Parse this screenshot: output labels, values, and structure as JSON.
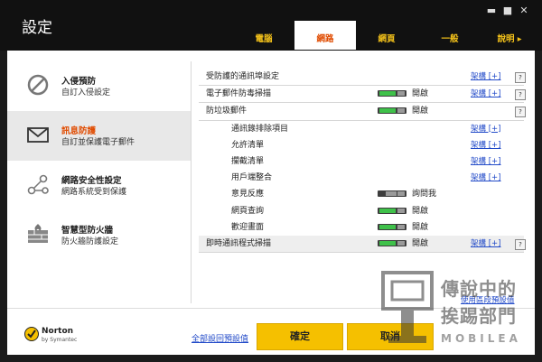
{
  "window": {
    "title": "設定"
  },
  "tabs": [
    {
      "label": "電腦",
      "active": false
    },
    {
      "label": "網路",
      "active": true
    },
    {
      "label": "網頁",
      "active": false
    },
    {
      "label": "一般",
      "active": false
    },
    {
      "label": "說明 ▸",
      "active": false
    }
  ],
  "nav": [
    {
      "title": "入侵預防",
      "subtitle": "自訂入侵設定",
      "icon": "no-entry-icon",
      "active": false
    },
    {
      "title": "訊息防護",
      "subtitle": "自訂並保護電子郵件",
      "icon": "envelope-icon",
      "active": true
    },
    {
      "title": "網路安全性設定",
      "subtitle": "網路系統受到保護",
      "icon": "network-nodes-icon",
      "active": false
    },
    {
      "title": "智慧型防火牆",
      "subtitle": "防火牆防護設定",
      "icon": "firewall-icon",
      "active": false
    }
  ],
  "settings": [
    {
      "label": "受防護的通訊埠設定",
      "toggle": null,
      "state": "",
      "config": "架構 [+]",
      "help": "?"
    },
    {
      "label": "電子郵件防毒掃描",
      "toggle": "on",
      "state": "開啟",
      "config": "架構 [+]",
      "help": "?"
    },
    {
      "label": "防垃圾郵件",
      "toggle": "on",
      "state": "開啟",
      "config": "",
      "help": "?"
    },
    {
      "label": "通訊錄排除項目",
      "toggle": null,
      "state": "",
      "config": "架構 [+]",
      "help": ""
    },
    {
      "label": "允許清單",
      "toggle": null,
      "state": "",
      "config": "架構 [+]",
      "help": ""
    },
    {
      "label": "攔截清單",
      "toggle": null,
      "state": "",
      "config": "架構 [+]",
      "help": ""
    },
    {
      "label": "用戶端整合",
      "toggle": null,
      "state": "",
      "config": "架構 [+]",
      "help": ""
    },
    {
      "label": "意見反應",
      "toggle": "mid",
      "state": "詢問我",
      "config": "",
      "help": ""
    },
    {
      "label": "網頁查詢",
      "toggle": "on",
      "state": "開啟",
      "config": "",
      "help": ""
    },
    {
      "label": "歡迎畫面",
      "toggle": "on",
      "state": "開啟",
      "config": "",
      "help": ""
    },
    {
      "label": "即時通訊程式掃描",
      "toggle": "on",
      "state": "開啟",
      "config": "架構 [+]",
      "help": "?"
    }
  ],
  "links": {
    "restore_section": "使用區段預設值",
    "restore_all": "全部設回預設值"
  },
  "buttons": {
    "ok": "確定",
    "cancel": "取消"
  },
  "brand": {
    "name": "Norton",
    "by": "by Symantec"
  },
  "watermark": {
    "line1": "傳說中的",
    "line2": "挨踢部門",
    "line3": "MOBILEA"
  },
  "colors": {
    "accent": "#e04b00",
    "tab_text": "#f4c21a",
    "button": "#f5c000",
    "toggle_on": "#3fc14a",
    "link": "#2049c8"
  }
}
